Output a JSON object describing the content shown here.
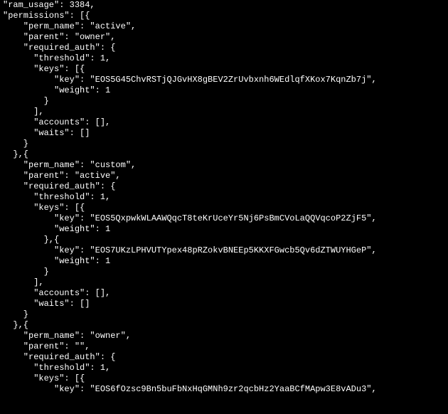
{
  "lines": [
    "\"ram_usage\": 3384,",
    "\"permissions\": [{",
    "    \"perm_name\": \"active\",",
    "    \"parent\": \"owner\",",
    "    \"required_auth\": {",
    "      \"threshold\": 1,",
    "      \"keys\": [{",
    "          \"key\": \"EOS5G45ChvRSTjQJGvHX8gBEV2ZrUvbxnh6WEdlqfXKox7KqnZb7j\",",
    "          \"weight\": 1",
    "        }",
    "      ],",
    "      \"accounts\": [],",
    "      \"waits\": []",
    "    }",
    "  },{",
    "    \"perm_name\": \"custom\",",
    "    \"parent\": \"active\",",
    "    \"required_auth\": {",
    "      \"threshold\": 1,",
    "      \"keys\": [{",
    "          \"key\": \"EOS5QxpwkWLAAWQqcT8teKrUceYr5Nj6PsBmCVoLaQQVqcoP2ZjF5\",",
    "          \"weight\": 1",
    "        },{",
    "          \"key\": \"EOS7UKzLPHVUTYpex48pRZokvBNEEp5KKXFGwcb5Qv6dZTWUYHGeP\",",
    "          \"weight\": 1",
    "        }",
    "      ],",
    "      \"accounts\": [],",
    "      \"waits\": []",
    "    }",
    "  },{",
    "    \"perm_name\": \"owner\",",
    "    \"parent\": \"\",",
    "    \"required_auth\": {",
    "      \"threshold\": 1,",
    "      \"keys\": [{",
    "          \"key\": \"EOS6fOzsc9Bn5buFbNxHqGMNh9zr2qcbHz2YaaBCfMApw3E8vADu3\","
  ]
}
